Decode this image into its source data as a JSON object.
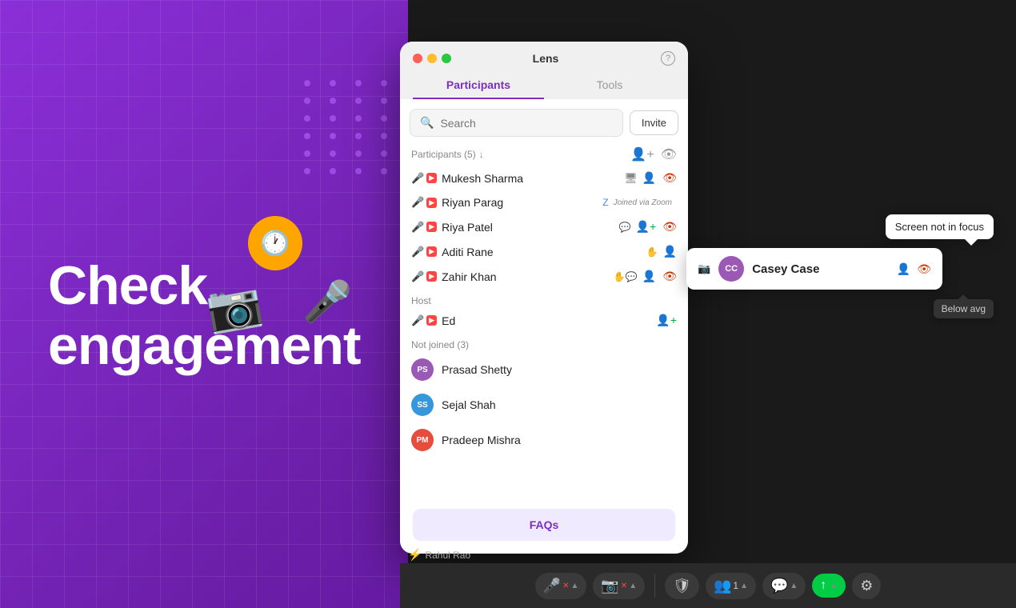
{
  "background": {
    "color": "#7B2FBE"
  },
  "hero": {
    "line1": "Check",
    "line2": "engagement"
  },
  "window": {
    "title": "Lens",
    "help_label": "?",
    "tabs": [
      "Participants",
      "Tools"
    ],
    "active_tab": "Participants"
  },
  "search": {
    "placeholder": "Search",
    "invite_label": "Invite"
  },
  "participants_section": {
    "label": "Participants (5)"
  },
  "participants": [
    {
      "name": "Mukesh Sharma",
      "has_ext": true,
      "has_cam": true,
      "has_cam_icon": true,
      "muted": true,
      "actions": [
        "add-remove",
        "eye-red"
      ]
    },
    {
      "name": "Riyan Parag",
      "has_ext": true,
      "has_cam": true,
      "badge": "Joined via Zoom",
      "muted": true,
      "actions": []
    },
    {
      "name": "Riya Patel",
      "has_ext": true,
      "has_cam": true,
      "emoji": "💬",
      "muted": true,
      "actions": [
        "add-green",
        "eye-red"
      ]
    },
    {
      "name": "Aditi Rane",
      "has_ext": true,
      "has_cam": true,
      "emoji": "✋",
      "muted": true,
      "actions": [
        "add-remove"
      ]
    },
    {
      "name": "Zahir Khan",
      "has_ext": true,
      "has_cam": true,
      "emoji": "✋💬",
      "muted": true,
      "actions": [
        "add-remove",
        "eye-red"
      ]
    }
  ],
  "host_section": {
    "label": "Host"
  },
  "host": {
    "name": "Ed",
    "muted": true,
    "has_cam": true,
    "actions": [
      "add-green"
    ]
  },
  "not_joined_section": {
    "label": "Not joined (3)"
  },
  "not_joined": [
    {
      "initials": "PS",
      "name": "Prasad Shetty",
      "color": "#9B59B6"
    },
    {
      "initials": "SS",
      "name": "Sejal Shah",
      "color": "#3498DB"
    },
    {
      "initials": "PM",
      "name": "Pradeep Mishra",
      "color": "#E74C3C"
    }
  ],
  "faqs": {
    "label": "FAQs"
  },
  "taskbar": {
    "user_name": "Rahul Rao"
  },
  "tooltip_screen": {
    "text": "Screen not in focus"
  },
  "casey": {
    "initials": "CC",
    "name": "Casey Case",
    "color": "#9B59B6"
  },
  "below_avg": {
    "text": "Below avg"
  }
}
